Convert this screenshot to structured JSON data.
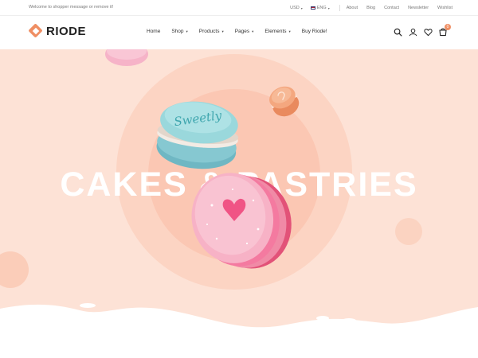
{
  "topbar": {
    "welcome": "Welcome to shopper message or remove it!",
    "currency": "USD",
    "language": "ENG",
    "links": [
      "About",
      "Blog",
      "Contact",
      "Newsletter",
      "Wishlist"
    ]
  },
  "header": {
    "logo_text": "RIODE",
    "nav": [
      {
        "label": "Home",
        "dropdown": false
      },
      {
        "label": "Shop",
        "dropdown": true
      },
      {
        "label": "Products",
        "dropdown": true
      },
      {
        "label": "Pages",
        "dropdown": true
      },
      {
        "label": "Elements",
        "dropdown": true
      },
      {
        "label": "Buy Riode!",
        "dropdown": false
      }
    ],
    "icons": [
      "search-icon",
      "user-icon",
      "heart-icon",
      "cart-icon"
    ],
    "cart_count": "0"
  },
  "hero": {
    "title": "CAKES & PASTRIES",
    "macaron_text": "Sweetly"
  },
  "colors": {
    "accent": "#ef8e63",
    "hero_bg": "#fde2d6",
    "macaron_blue": "#9ad8dc",
    "macaron_pink": "#f47aa0",
    "macaron_peach": "#f4a77f"
  }
}
